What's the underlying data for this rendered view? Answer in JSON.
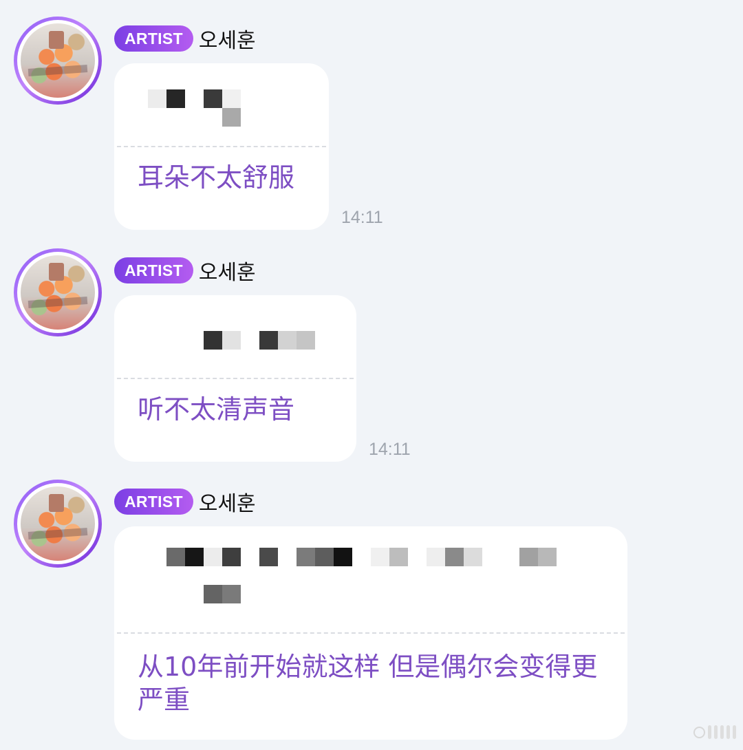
{
  "messages": [
    {
      "artist_badge": "ARTIST",
      "artist_name": "오세훈",
      "translation": "耳朵不太舒服",
      "time": "14:11"
    },
    {
      "artist_badge": "ARTIST",
      "artist_name": "오세훈",
      "translation": "听不太清声音",
      "time": "14:11"
    },
    {
      "artist_badge": "ARTIST",
      "artist_name": "오세훈",
      "translation": "从10年前开始就这样 但是偶尔会变得更严重",
      "time": ""
    }
  ],
  "colors": {
    "background": "#f1f4f8",
    "bubble": "#ffffff",
    "translation_text": "#7d4ec3",
    "badge_start": "#7b3fe4",
    "badge_end": "#b45cf0",
    "time_text": "#9ea4ad"
  }
}
